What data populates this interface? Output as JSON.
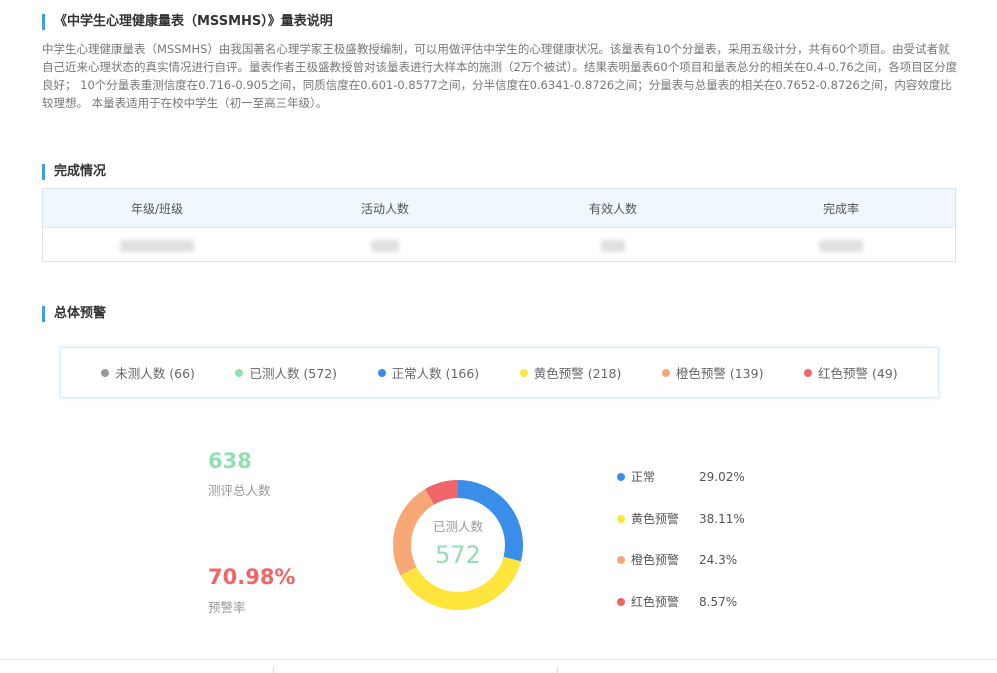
{
  "scale_intro": {
    "title": "《中学生心理健康量表（MSSMHS）》量表说明",
    "description": "中学生心理健康量表（MSSMHS）由我国著名心理学家王极盛教授编制，可以用做评估中学生的心理健康状况。该量表有10个分量表，采用五级计分，共有60个项目。由受试者就自己近来心理状态的真实情况进行自评。量表作者王极盛教授曾对该量表进行大样本的施测（2万个被试）。结果表明量表60个项目和量表总分的相关在0.4-0.76之间，各项目区分度良好； 10个分量表重测信度在0.716-0.905之间，同质信度在0.601-0.8577之间，分半信度在0.6341-0.8726之间；分量表与总量表的相关在0.7652-0.8726之间，内容效度比较理想。 本量表适用于在校中学生（初一至高三年级）。"
  },
  "completion": {
    "title": "完成情况",
    "columns": [
      "年级/班级",
      "活动人数",
      "有效人数",
      "完成率"
    ]
  },
  "warning": {
    "title": "总体预警",
    "legend": [
      {
        "label": "未测人数 (66)",
        "color": "#999999"
      },
      {
        "label": "已测人数 (572)",
        "color": "#93dfb2"
      },
      {
        "label": "正常人数 (166)",
        "color": "#3b8ee8"
      },
      {
        "label": "黄色预警 (218)",
        "color": "#fde53c"
      },
      {
        "label": "橙色预警 (139)",
        "color": "#f8a877"
      },
      {
        "label": "红色预警 (49)",
        "color": "#f06565"
      }
    ],
    "total_count": "638",
    "total_label": "测评总人数",
    "warning_rate": "70.98%",
    "warning_rate_label": "预警率",
    "donut": {
      "center_label": "已测人数",
      "center_value": "572",
      "segments": [
        {
          "name": "正常",
          "value": 166,
          "color": "#3b8ee8"
        },
        {
          "name": "黄色预警",
          "value": 218,
          "color": "#fde53c"
        },
        {
          "name": "橙色预警",
          "value": 139,
          "color": "#f8a877"
        },
        {
          "name": "红色预警",
          "value": 49,
          "color": "#f06565"
        }
      ]
    },
    "breakdown": [
      {
        "name": "正常",
        "percent": "29.02%",
        "color": "#3b8ee8"
      },
      {
        "name": "黄色预警",
        "percent": "38.11%",
        "color": "#fde53c"
      },
      {
        "name": "橙色预警",
        "percent": "24.3%",
        "color": "#f8a877"
      },
      {
        "name": "红色预警",
        "percent": "8.57%",
        "color": "#f06565"
      }
    ]
  }
}
